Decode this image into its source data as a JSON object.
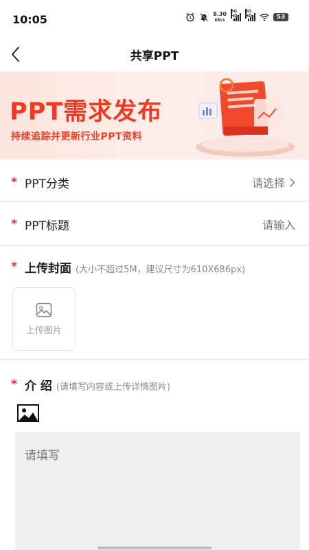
{
  "status": {
    "time": "10:05",
    "speed_value": "8.30",
    "speed_unit": "KB/s",
    "sim1": "5G HD",
    "sim2": "5G HD",
    "battery": "53"
  },
  "nav": {
    "title": "共享PPT"
  },
  "banner": {
    "title": "PPT需求发布",
    "subtitle": "持续追踪并更新行业PPT资料"
  },
  "form": {
    "required_mark": "*",
    "category": {
      "label": "PPT分类",
      "value": "请选择"
    },
    "title": {
      "label": "PPT标题",
      "placeholder": "请输入"
    },
    "cover": {
      "label": "上传封面",
      "hint": "(大小不超过5M，建议尺寸为610X686px)",
      "upload_label": "上传图片"
    },
    "intro": {
      "label": "介 绍",
      "hint": "(请填写内容或上传详情图片)",
      "placeholder": "请填写"
    }
  },
  "colors": {
    "accent": "#ee3a23",
    "required": "#d8332a",
    "banner_bg": "#fde4de"
  }
}
